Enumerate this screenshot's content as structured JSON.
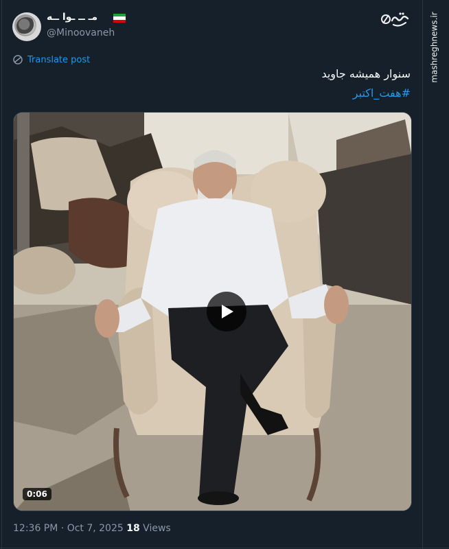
{
  "author": {
    "display_name": "مـ ــ ـوا ــه",
    "handle": "@Minoovaneh",
    "flag_icon": "iran-flag-icon",
    "avatar_icon": "globe-avatar"
  },
  "watermark": {
    "logo_text": "مشرق",
    "url": "mashreghnews.ir"
  },
  "translate": {
    "label": "Translate post",
    "icon": "globe-icon"
  },
  "post": {
    "text": "سنوار همیشه جاوید",
    "hashtag": "#هفت_اکتبر"
  },
  "media": {
    "type": "video",
    "duration": "0:06",
    "play_icon": "play-icon"
  },
  "meta": {
    "time": "12:36 PM",
    "separator": " · ",
    "date": "Oct 7, 2025",
    "views_count": "18",
    "views_label": "Views"
  },
  "colors": {
    "background": "#15202b",
    "link": "#1d9bf0",
    "muted": "#8b98a5",
    "text": "#f7f9f9"
  }
}
